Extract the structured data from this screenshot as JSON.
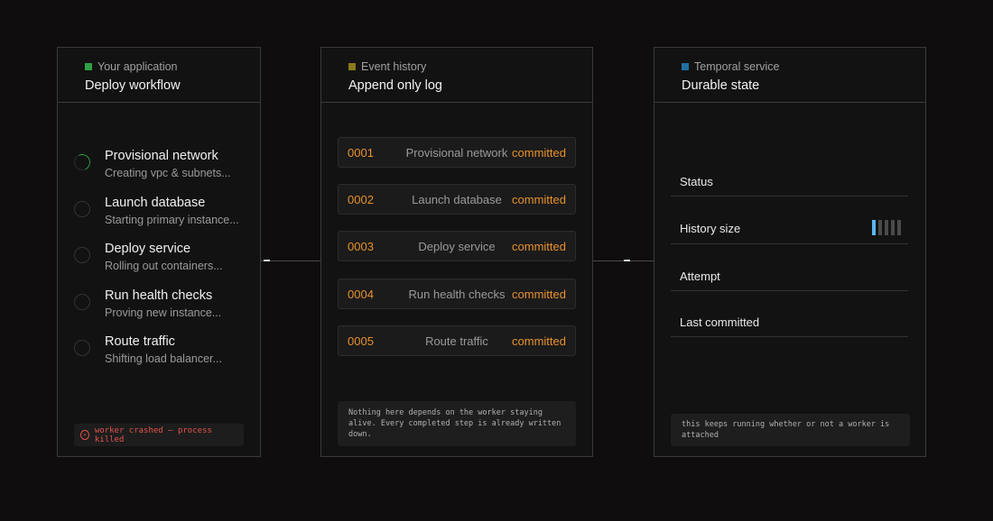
{
  "app": {
    "kicker": "Your application",
    "title": "Deploy workflow",
    "steps": [
      {
        "title": "Provisional network",
        "subtitle": "Creating vpc & subnets..."
      },
      {
        "title": "Launch database",
        "subtitle": "Starting primary instance..."
      },
      {
        "title": "Deploy service",
        "subtitle": "Rolling out containers..."
      },
      {
        "title": "Run health checks",
        "subtitle": "Proving new instance..."
      },
      {
        "title": "Route traffic",
        "subtitle": "Shifting load balancer..."
      }
    ],
    "crash_message": "worker crashed — process killed",
    "crash_icon": "x-circle-icon"
  },
  "history": {
    "kicker": "Event history",
    "title": "Append only log",
    "entries": [
      {
        "id": "0001",
        "name": "Provisional network",
        "status": "committed"
      },
      {
        "id": "0002",
        "name": "Launch database",
        "status": "committed"
      },
      {
        "id": "0003",
        "name": "Deploy service",
        "status": "committed"
      },
      {
        "id": "0004",
        "name": "Run health checks",
        "status": "committed"
      },
      {
        "id": "0005",
        "name": "Route traffic",
        "status": "committed"
      }
    ],
    "note": "Nothing here depends on the worker staying alive. Every completed step is already written down."
  },
  "service": {
    "kicker": "Temporal service",
    "title": "Durable state",
    "rows": [
      {
        "label": "Status"
      },
      {
        "label": "History size"
      },
      {
        "label": "Attempt"
      },
      {
        "label": "Last committed"
      }
    ],
    "history_size_bars": {
      "filled": 1,
      "total": 5
    },
    "note": "this keeps running whether or not a worker is attached"
  },
  "colors": {
    "app_marker": "#2ea043",
    "history_marker": "#8a7a1a",
    "service_marker": "#1f6fa3",
    "accent_orange": "#e8912d",
    "error_red": "#e5534b",
    "bar_active": "#58b6f0"
  }
}
